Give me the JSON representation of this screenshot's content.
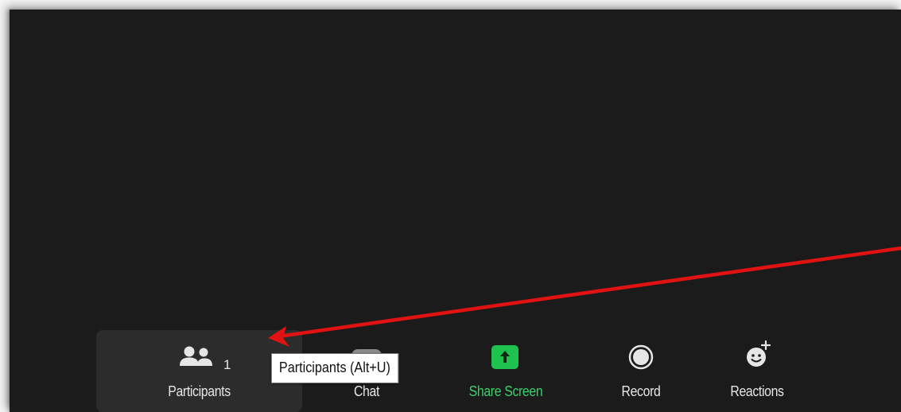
{
  "toolbar": {
    "participants": {
      "label": "Participants",
      "count": "1",
      "icon": "participants-icon"
    },
    "chat": {
      "label": "Chat",
      "icon": "chat-icon"
    },
    "share_screen": {
      "label": "Share Screen",
      "icon": "share-screen-icon",
      "color": "#1fc24f"
    },
    "record": {
      "label": "Record",
      "icon": "record-icon"
    },
    "reactions": {
      "label": "Reactions",
      "icon": "reactions-icon"
    }
  },
  "tooltip": {
    "text": "Participants (Alt+U)"
  },
  "annotation": {
    "arrow_color": "#e11212"
  }
}
